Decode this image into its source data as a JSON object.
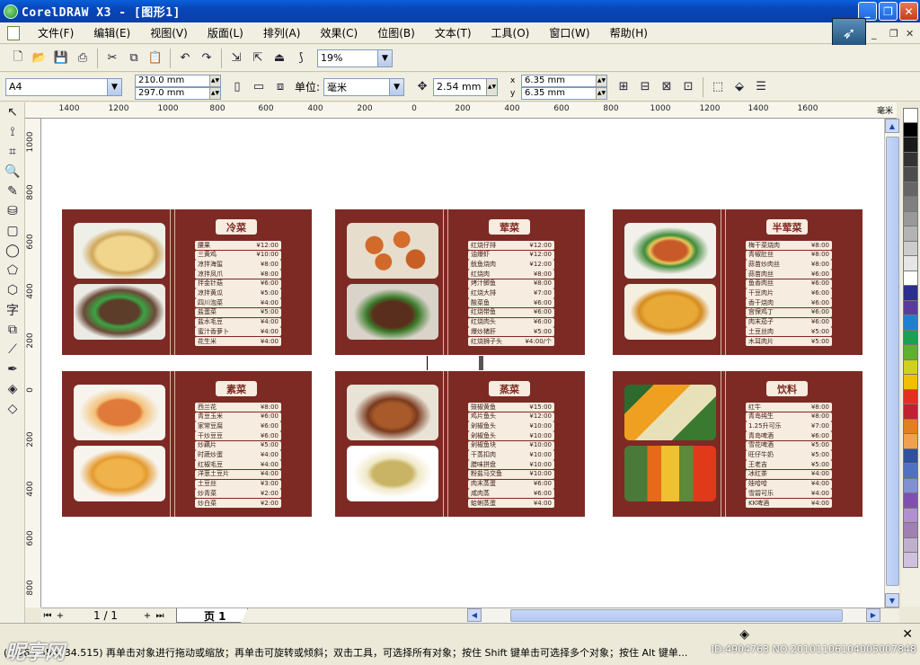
{
  "window": {
    "title": "CorelDRAW X3 - [图形1]"
  },
  "menu": [
    "文件(F)",
    "编辑(E)",
    "视图(V)",
    "版面(L)",
    "排列(A)",
    "效果(C)",
    "位图(B)",
    "文本(T)",
    "工具(O)",
    "窗口(W)",
    "帮助(H)"
  ],
  "toolbar": {
    "zoom": "19%"
  },
  "property_bar": {
    "page_size": "A4",
    "width": "210.0 mm",
    "height": "297.0 mm",
    "unit_label": "单位:",
    "unit": "毫米",
    "nudge": "2.54 mm",
    "dup_x": "6.35 mm",
    "dup_y": "6.35 mm",
    "x_label": "x",
    "y_label": "y"
  },
  "ruler": {
    "unit": "毫米",
    "h_ticks": [
      "1400",
      "1200",
      "1000",
      "800",
      "600",
      "400",
      "200",
      "0",
      "200",
      "400",
      "600",
      "800",
      "1000",
      "1200",
      "1400",
      "1600"
    ],
    "v_ticks": [
      "1000",
      "800",
      "600",
      "400",
      "200",
      "0",
      "200",
      "400",
      "600",
      "800"
    ]
  },
  "panels": [
    {
      "title": "冷菜",
      "photos": [
        "ph-chicken",
        "ph-beef"
      ],
      "items": [
        [
          "腰果",
          "¥12:00"
        ],
        [
          "三黄鸡",
          "¥10:00"
        ],
        [
          "凉拌海蜇",
          "¥8:00"
        ],
        [
          "凉拌凤爪",
          "¥8:00"
        ],
        [
          "拌金针菇",
          "¥6:00"
        ],
        [
          "凉拌黄瓜",
          "¥5:00"
        ],
        [
          "四川泡菜",
          "¥4:00"
        ],
        [
          "盐蛋菜",
          "¥5:00"
        ],
        [
          "盐水毛豆",
          "¥4:00"
        ],
        [
          "蜜汁香萝卜",
          "¥4:00"
        ],
        [
          "花生米",
          "¥4:00"
        ]
      ]
    },
    {
      "title": "荤菜",
      "photos": [
        "ph-shrimp",
        "ph-pork"
      ],
      "items": [
        [
          "红烧仔排",
          "¥12:00"
        ],
        [
          "油爆虾",
          "¥12:00"
        ],
        [
          "鱿鱼烧肉",
          "¥12:00"
        ],
        [
          "红烧肉",
          "¥8:00"
        ],
        [
          "烤汁鲫鱼",
          "¥8:00"
        ],
        [
          "红烧大排",
          "¥7:00"
        ],
        [
          "酸菜鱼",
          "¥6:00"
        ],
        [
          "红烧带鱼",
          "¥6:00"
        ],
        [
          "红烧肉头",
          "¥6:00"
        ],
        [
          "爆炒猪肝",
          "¥5:00"
        ],
        [
          "红烧狮子头",
          "¥4:00/个"
        ]
      ]
    },
    {
      "title": "半荤菜",
      "photos": [
        "ph-mixed",
        "ph-pancake"
      ],
      "items": [
        [
          "梅干菜烧肉",
          "¥8:00"
        ],
        [
          "青椒肚丝",
          "¥8:00"
        ],
        [
          "蒜苗炒肉丝",
          "¥8:00"
        ],
        [
          "蒜苗肉丝",
          "¥6:00"
        ],
        [
          "鱼香肉丝",
          "¥6:00"
        ],
        [
          "干豆肉片",
          "¥6:00"
        ],
        [
          "香干烧肉",
          "¥6:00"
        ],
        [
          "宫保鸡丁",
          "¥6:00"
        ],
        [
          "肉末茄子",
          "¥6:00"
        ],
        [
          "土豆丝肉",
          "¥5:00"
        ],
        [
          "木耳肉片",
          "¥5:00"
        ]
      ]
    },
    {
      "title": "素菜",
      "photos": [
        "ph-tofu",
        "ph-egg"
      ],
      "items": [
        [
          "西兰花",
          "¥8:00"
        ],
        [
          "青豆玉米",
          "¥6:00"
        ],
        [
          "家常豆腐",
          "¥6:00"
        ],
        [
          "干炒豆豆",
          "¥6:00"
        ],
        [
          "炒藕片",
          "¥5:00"
        ],
        [
          "时蔬炒蛋",
          "¥4:00"
        ],
        [
          "红椒毛豆",
          "¥4:00"
        ],
        [
          "洋葱土豆片",
          "¥4:00"
        ],
        [
          "土豆丝",
          "¥3:00"
        ],
        [
          "炒青菜",
          "¥2:00"
        ],
        [
          "炒白菜",
          "¥2:00"
        ]
      ]
    },
    {
      "title": "蒸菜",
      "photos": [
        "ph-fish",
        "ph-soup"
      ],
      "items": [
        [
          "豉椒黄鱼",
          "¥15:00"
        ],
        [
          "鸡片鱼头",
          "¥12:00"
        ],
        [
          "剁椒鱼头",
          "¥10:00"
        ],
        [
          "剁椒鱼头",
          "¥10:00"
        ],
        [
          "剁椒鱼块",
          "¥10:00"
        ],
        [
          "干蒸扣肉",
          "¥10:00"
        ],
        [
          "腊味拼盘",
          "¥10:00"
        ],
        [
          "粉盐马交鱼",
          "¥10:00"
        ],
        [
          "肉末蒸蛋",
          "¥6:00"
        ],
        [
          "咸肉蒸",
          "¥6:00"
        ],
        [
          "蛤蜊蒸蛋",
          "¥4:00"
        ]
      ]
    },
    {
      "title": "饮料",
      "photos": [
        "ph-juice",
        "ph-drinks"
      ],
      "items": [
        [
          "红牛",
          "¥8:00"
        ],
        [
          "青岛纯生",
          "¥8:00"
        ],
        [
          "1.25升可乐",
          "¥7:00"
        ],
        [
          "青岛啤酒",
          "¥6:00"
        ],
        [
          "雪花啤酒",
          "¥5:00"
        ],
        [
          "旺仔牛奶",
          "¥5:00"
        ],
        [
          "王老吉",
          "¥5:00"
        ],
        [
          "冰红茶",
          "¥4:00"
        ],
        [
          "娃哈哈",
          "¥4:00"
        ],
        [
          "雪碧可乐",
          "¥4:00"
        ],
        [
          "KK啤酒",
          "¥4:00"
        ]
      ]
    }
  ],
  "pagebar": {
    "counter": "1 / 1",
    "page_tab": "页 1"
  },
  "status": {
    "hint": "(-1563.556, 34.515)   再单击对象进行拖动或缩放；再单击可旋转或倾斜；双击工具，可选择所有对象；按住 Shift 键单击可选择多个对象；按住 Alt 键单...",
    "watermark": "昵享网",
    "id": "ID:4904763 NO:20101106104005007848"
  },
  "palette": [
    "#ffffff",
    "#000000",
    "#1a1a1a",
    "#333333",
    "#4d4d4d",
    "#666666",
    "#808080",
    "#999999",
    "#b3b3b3",
    "#cccccc",
    "#e6e6e6",
    "#ffffff",
    "#2b2f8f",
    "#5b3c9e",
    "#2080d0",
    "#1aa050",
    "#60b030",
    "#d0d020",
    "#f0c000",
    "#e03020",
    "#c02030",
    "#e08020",
    "#f0a050",
    "#3050a0",
    "#5070c0",
    "#8090d0",
    "#8050b0",
    "#b090d0",
    "#a080b0",
    "#c0b0d0",
    "#d0c0e0"
  ]
}
